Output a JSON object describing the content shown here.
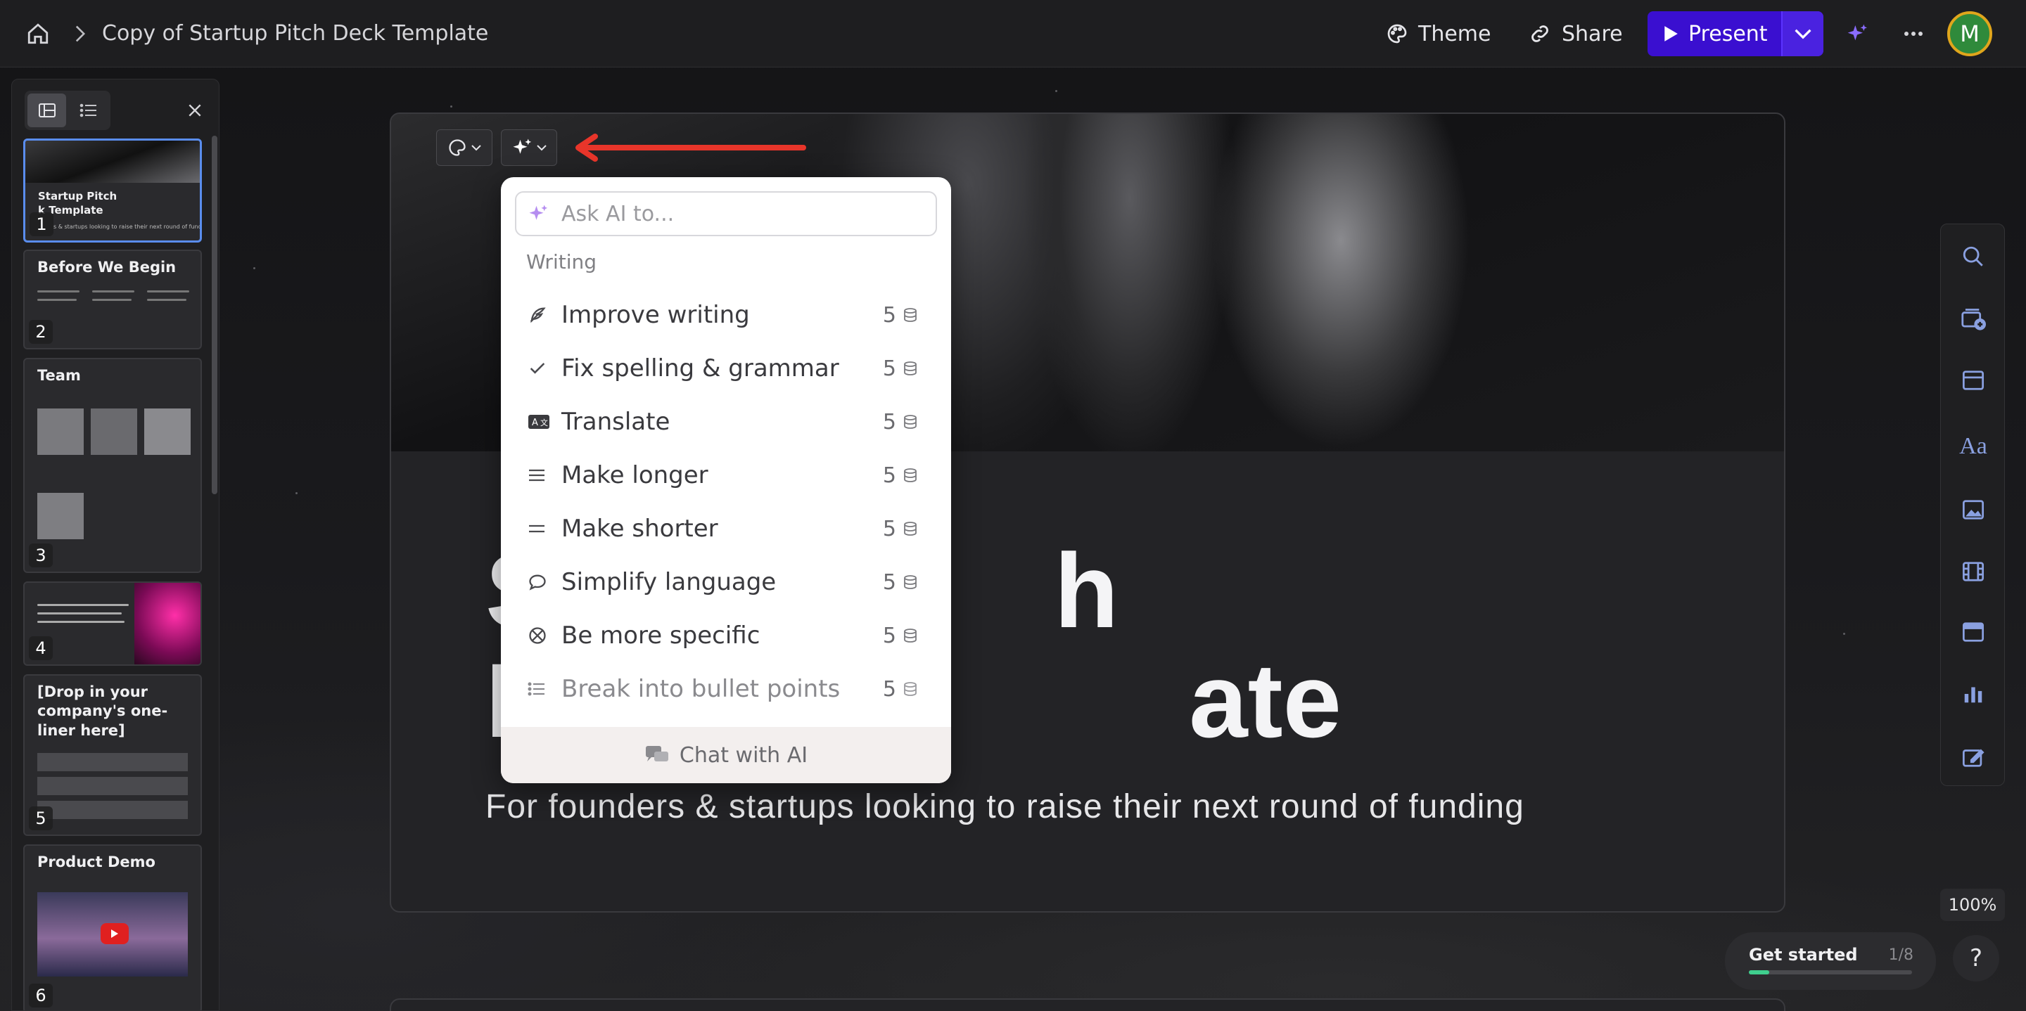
{
  "header": {
    "doc_title": "Copy of Startup Pitch Deck Template",
    "theme_label": "Theme",
    "share_label": "Share",
    "present_label": "Present",
    "avatar_initial": "M",
    "accent": "#3a0fd0"
  },
  "sidebar": {
    "slides": [
      {
        "number": "1",
        "title": "Startup Pitch\nk Template",
        "subtitle": "s & startups looking to raise their next round of funding"
      },
      {
        "number": "2",
        "title": "Before We Begin"
      },
      {
        "number": "3",
        "title": "Team"
      },
      {
        "number": "4",
        "title": ""
      },
      {
        "number": "5",
        "title": "[Drop in your company's one-liner here]"
      },
      {
        "number": "6",
        "title": "Product Demo"
      }
    ]
  },
  "slide": {
    "title_visible": "S                 h\nI                       ate",
    "subtitle": "For founders & startups looking to raise their next round of funding"
  },
  "ai_menu": {
    "placeholder": "Ask AI to...",
    "section": "Writing",
    "items": [
      {
        "label": "Improve writing",
        "cost": "5",
        "icon": "feather-icon"
      },
      {
        "label": "Fix spelling & grammar",
        "cost": "5",
        "icon": "check-icon"
      },
      {
        "label": "Translate",
        "cost": "5",
        "icon": "translate-icon"
      },
      {
        "label": "Make longer",
        "cost": "5",
        "icon": "lines-icon"
      },
      {
        "label": "Make shorter",
        "cost": "5",
        "icon": "short-lines-icon"
      },
      {
        "label": "Simplify language",
        "cost": "5",
        "icon": "speech-bubble-icon"
      },
      {
        "label": "Be more specific",
        "cost": "5",
        "icon": "target-icon"
      },
      {
        "label": "Break into bullet points",
        "cost": "5",
        "icon": "bullet-list-icon"
      }
    ],
    "footer": "Chat with AI"
  },
  "status": {
    "zoom": "100%",
    "get_started": "Get started",
    "progress_text": "1/8",
    "progress_fraction": 0.125,
    "help": "?"
  }
}
